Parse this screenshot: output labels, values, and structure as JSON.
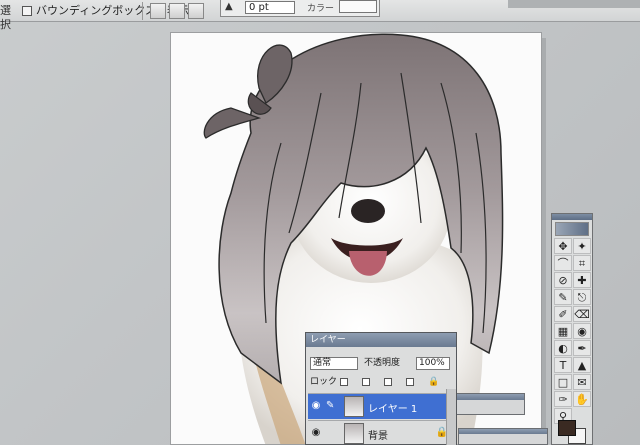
{
  "options_bar": {
    "select_label": "選択",
    "bounding_box_label": "バウンディングボックスを表示",
    "stroke_weight_prefix": "▲",
    "stroke_weight_value": "0 pt",
    "color_label": "カラー"
  },
  "layers_panel": {
    "title": "レイヤー",
    "blend_mode": "通常",
    "opacity_label": "不透明度",
    "opacity_value": "100%",
    "lock_label": "ロック",
    "layers": [
      {
        "name": "レイヤー 1",
        "selected": true
      },
      {
        "name": "背景",
        "selected": false,
        "locked": true
      }
    ]
  },
  "tools": [
    "move-tool",
    "magic-wand-tool",
    "lasso-tool",
    "crop-tool",
    "slice-tool",
    "healing-brush-tool",
    "brush-tool",
    "stamp-tool",
    "history-brush-tool",
    "eraser-tool",
    "gradient-tool",
    "blur-tool",
    "dodge-tool",
    "pen-tool",
    "type-tool",
    "path-select-tool",
    "shape-tool",
    "notes-tool",
    "eyedropper-tool",
    "hand-tool",
    "zoom-tool"
  ],
  "tool_glyphs": [
    "✥",
    "✦",
    "⌒",
    "⌗",
    "⊘",
    "✚",
    "✎",
    "⎋",
    "✐",
    "⌫",
    "▦",
    "◉",
    "◐",
    "✒",
    "T",
    "▲",
    "□",
    "✉",
    "✑",
    "✋",
    "⚲"
  ],
  "colors": {
    "foreground": "#3a2a22",
    "background": "#f6f6f6",
    "selection": "#3f6fd2"
  }
}
